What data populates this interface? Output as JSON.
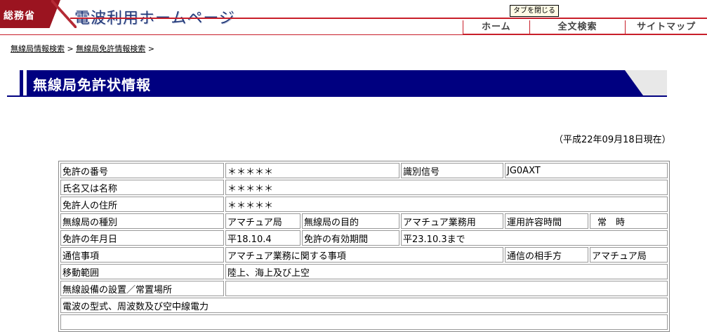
{
  "header": {
    "logo_text": "総務省",
    "site_title": "電波利用ホームページ",
    "close_tab_label": "タブを閉じる",
    "nav": [
      {
        "label": "ホーム"
      },
      {
        "label": "全文検索"
      },
      {
        "label": "サイトマップ"
      }
    ]
  },
  "breadcrumb": {
    "item1": "無線局情報検索",
    "sep1": " > ",
    "item2": "無線局免許情報検索",
    "sep2": " >"
  },
  "page_title": "無線局免許状情報",
  "as_of": "（平成22年09月18日現在）",
  "license": {
    "license_number_label": "免許の番号",
    "license_number": "＊＊＊＊＊",
    "call_sign_label": "識別信号",
    "call_sign": "JG0AXT",
    "name_label": "氏名又は名称",
    "name": "＊＊＊＊＊",
    "address_label": "免許人の住所",
    "address": "＊＊＊＊＊",
    "station_type_label": "無線局の種別",
    "station_type": "アマチュア局",
    "purpose_label": "無線局の目的",
    "purpose": "アマチュア業務用",
    "operating_hours_label": "運用許容時間",
    "operating_hours": "常　時",
    "license_date_label": "免許の年月日",
    "license_date": "平18.10.4",
    "validity_label": "免許の有効期間",
    "validity": "平23.10.3まで",
    "comm_matters_label": "通信事項",
    "comm_matters": "アマチュア業務に関する事項",
    "counterpart_label": "通信の相手方",
    "counterpart": "アマチュア局",
    "movement_label": "移動範囲",
    "movement": "陸上、海上及び上空",
    "install_location_label": "無線設備の設置／常置場所",
    "install_location": "",
    "emission_label": "電波の型式、周波数及び空中線電力"
  }
}
